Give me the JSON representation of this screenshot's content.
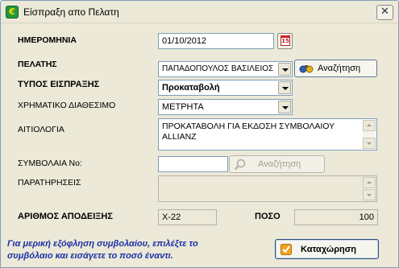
{
  "window": {
    "title": "Είσπραξη απο Πελατη",
    "close_glyph": "✕"
  },
  "form": {
    "date": {
      "label": "ΗΜΕΡΟΜΗΝΙΑ",
      "value": "01/10/2012",
      "calendar_glyph": "15"
    },
    "customer": {
      "label": "ΠΕΛΑΤΗΣ",
      "value": "ΠΑΠΑΔΟΠΟΥΛΟΣ ΒΑΣΙΛΕΙΟΣ",
      "search_label": "Αναζήτηση"
    },
    "receipt_type": {
      "label": "ΤΥΠΟΣ ΕΙΣΠΡΑΞΗΣ",
      "value": "Προκαταβολή"
    },
    "cash_account": {
      "label": "ΧΡΗΜΑΤΙΚΟ ΔΙΑΘΕΣΙΜΟ",
      "value": "ΜΕΤΡΗΤΑ"
    },
    "reason": {
      "label": "ΑΙΤΙΟΛΟΓΙΑ",
      "value": "ΠΡΟΚΑΤΑΒΟΛΗ ΓΙΑ ΕΚΔΟΣΗ ΣΥΜΒΟΛΑΙΟΥ ALLIANZ"
    },
    "contract_no": {
      "label": "ΣΥΜΒΟΛΑΙΑ Νο:",
      "value": "",
      "search_label": "Αναζήτηση"
    },
    "notes": {
      "label": "ΠΑΡΑΤΗΡΗΣΕΙΣ",
      "value": ""
    },
    "receipt_no": {
      "label": "ΑΡΙΘΜΟΣ ΑΠΟΔΕΙΞΗΣ",
      "value": "X-22"
    },
    "amount": {
      "label": "ΠΟΣΟ",
      "value": "100"
    }
  },
  "footer": {
    "hint": "Για μερική εξόφληση συμβολαίου, επιλέξτε το συμβόλαιο και εισάγετε το ποσό έναντι.",
    "submit_label": "Καταχώρηση"
  },
  "colors": {
    "hint_text": "#1b2fa8",
    "dialog_bg": "#ece9d8",
    "field_border": "#7f9db9"
  }
}
